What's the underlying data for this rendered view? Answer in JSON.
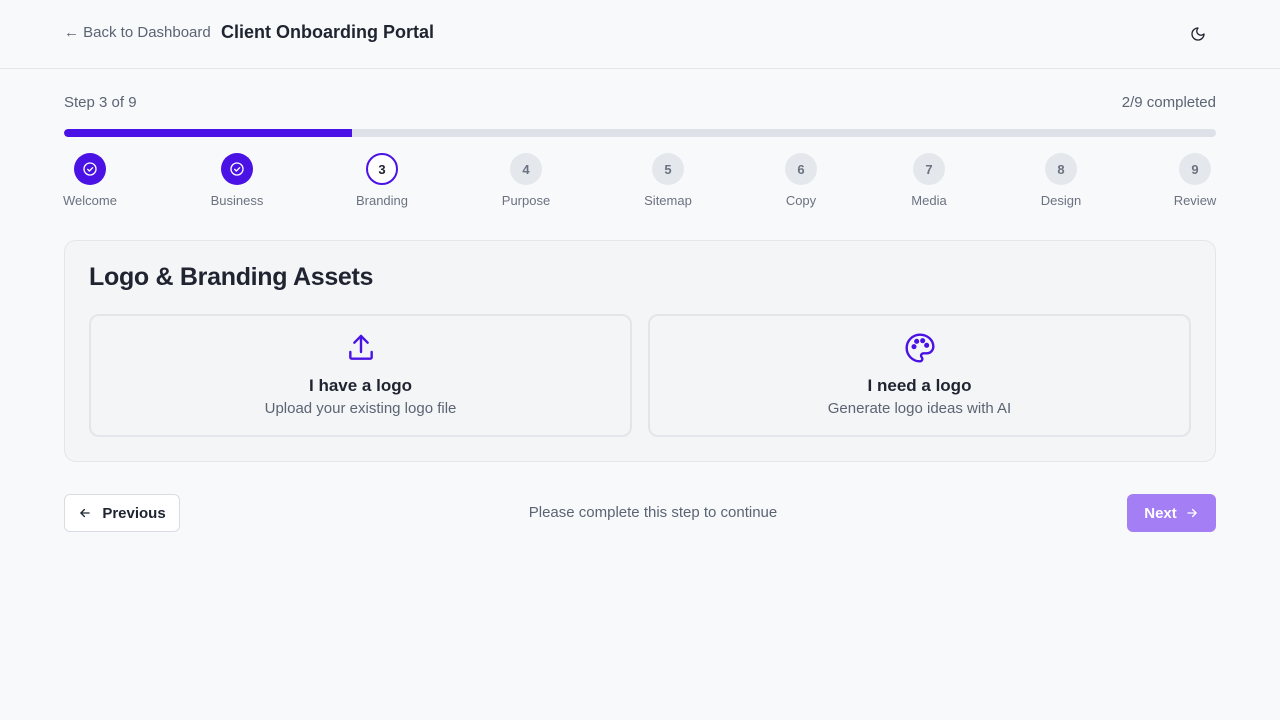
{
  "header": {
    "back_link": "← Back to Dashboard",
    "title": "Client Onboarding Portal",
    "theme_toggle_icon": "moon-icon"
  },
  "progress": {
    "step_label": "Step 3 of 9",
    "completed_label": "2/9 completed",
    "fraction": 0.25,
    "accent_color": "#4a12e4"
  },
  "steps": [
    {
      "number": "1",
      "label": "Welcome",
      "state": "completed"
    },
    {
      "number": "2",
      "label": "Business",
      "state": "completed"
    },
    {
      "number": "3",
      "label": "Branding",
      "state": "current"
    },
    {
      "number": "4",
      "label": "Purpose",
      "state": "upcoming"
    },
    {
      "number": "5",
      "label": "Sitemap",
      "state": "upcoming"
    },
    {
      "number": "6",
      "label": "Copy",
      "state": "upcoming"
    },
    {
      "number": "7",
      "label": "Media",
      "state": "upcoming"
    },
    {
      "number": "8",
      "label": "Design",
      "state": "upcoming"
    },
    {
      "number": "9",
      "label": "Review",
      "state": "upcoming"
    }
  ],
  "card": {
    "title": "Logo & Branding Assets",
    "options": [
      {
        "title": "I have a logo",
        "description": "Upload your existing logo file",
        "icon": "upload-icon"
      },
      {
        "title": "I need a logo",
        "description": "Generate logo ideas with AI",
        "icon": "palette-icon"
      }
    ]
  },
  "footer": {
    "previous_label": "Previous",
    "status_message": "Please complete this step to continue",
    "next_label": "Next"
  }
}
